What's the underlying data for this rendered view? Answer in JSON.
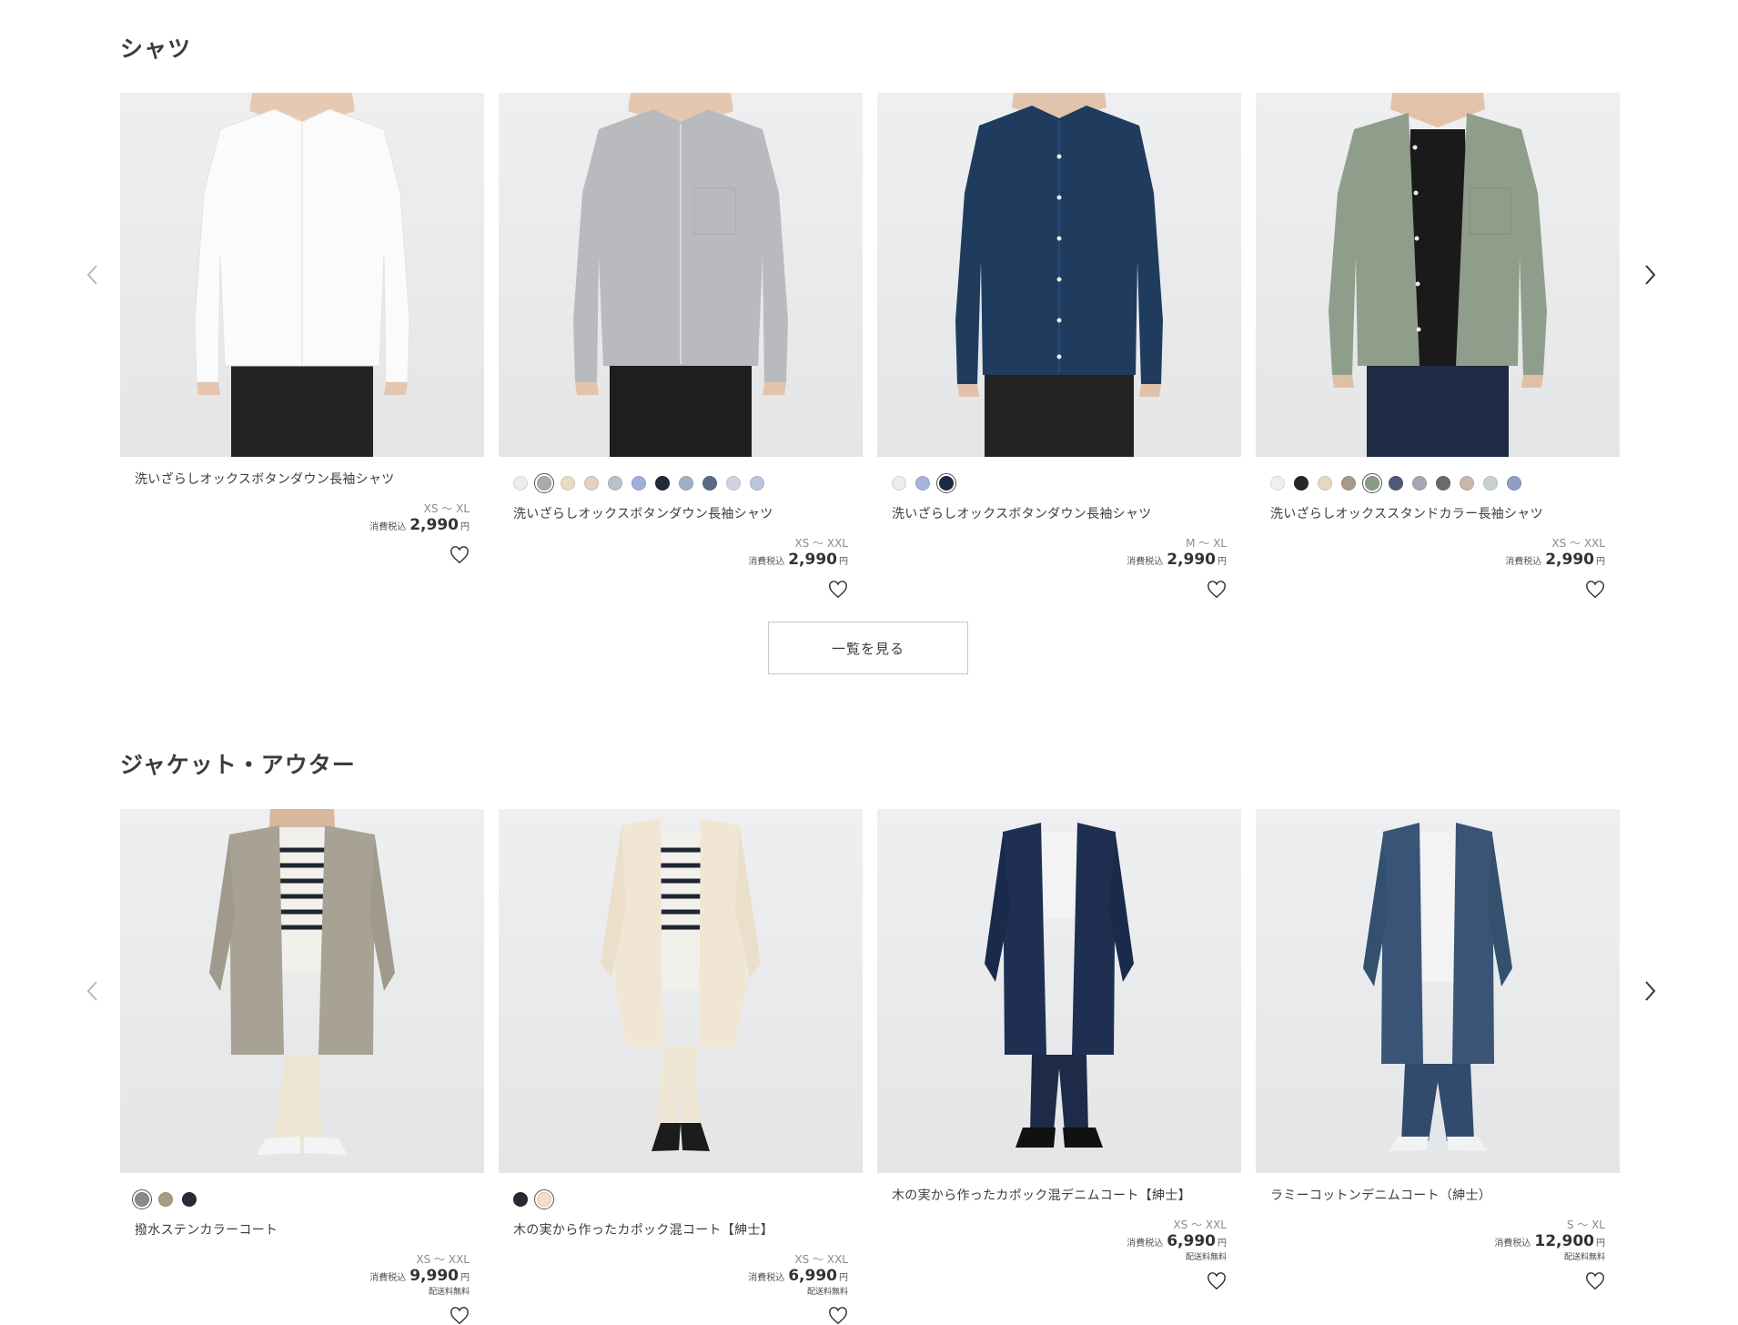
{
  "sections": [
    {
      "title": "シャツ",
      "view_all_label": "一覧を見る",
      "products": [
        {
          "name": "洗いざらしオックスボタンダウン長袖シャツ",
          "sizes": "XS 〜 XL",
          "tax_label": "消費税込",
          "price": "2,990",
          "currency": "円",
          "shipping": "",
          "swatches": [],
          "image_icon": "white-shirt-photo"
        },
        {
          "name": "洗いざらしオックスボタンダウン長袖シャツ",
          "sizes": "XS 〜 XXL",
          "tax_label": "消費税込",
          "price": "2,990",
          "currency": "円",
          "shipping": "",
          "swatches": [
            "#ececec",
            "#a9aab1",
            "#e8dcc6",
            "#e6cfbf",
            "#b6c3c9",
            "#9fb0db",
            "#1f2a3d",
            "#9fb0c4",
            "#5a6b86",
            "#cfd4e0",
            "#b9c6dc"
          ],
          "selected_swatch": 1,
          "image_icon": "gray-shirt-photo"
        },
        {
          "name": "洗いざらしオックスボタンダウン長袖シャツ",
          "sizes": "M 〜 XL",
          "tax_label": "消費税込",
          "price": "2,990",
          "currency": "円",
          "shipping": "",
          "swatches": [
            "#ececec",
            "#a9b4dc",
            "#1c2b44"
          ],
          "selected_swatch": 2,
          "image_icon": "navy-shirt-photo"
        },
        {
          "name": "洗いざらしオックススタンドカラー長袖シャツ",
          "sizes": "XS 〜 XXL",
          "tax_label": "消費税込",
          "price": "2,990",
          "currency": "円",
          "shipping": "",
          "swatches": [
            "#efefef",
            "#262626",
            "#e6d8c2",
            "#a79a8a",
            "#8a9b86",
            "#4d5a74",
            "#aaa5b6",
            "#6a6a6a",
            "#c9b7ac",
            "#c9d2d1",
            "#8e9fc4"
          ],
          "selected_swatch": 4,
          "image_icon": "green-shirt-photo"
        }
      ]
    },
    {
      "title": "ジャケット・アウター",
      "view_all_label": "",
      "products": [
        {
          "name": "撥水ステンカラーコート",
          "sizes": "XS 〜 XXL",
          "tax_label": "消費税込",
          "price": "9,990",
          "currency": "円",
          "shipping": "配送料無料",
          "swatches": [
            "#8e8a80",
            "#a89a84",
            "#262d36"
          ],
          "selected_swatch": 0,
          "image_icon": "beige-coat-photo"
        },
        {
          "name": "木の実から作ったカポック混コート【紳士】",
          "sizes": "XS 〜 XXL",
          "tax_label": "消費税込",
          "price": "6,990",
          "currency": "円",
          "shipping": "配送料無料",
          "swatches": [
            "#252a30",
            "#f1dfca"
          ],
          "selected_swatch": 1,
          "image_icon": "cream-coat-photo"
        },
        {
          "name": "木の実から作ったカポック混デニムコート【紳士】",
          "sizes": "XS 〜 XXL",
          "tax_label": "消費税込",
          "price": "6,990",
          "currency": "円",
          "shipping": "配送料無料",
          "swatches": [],
          "image_icon": "dark-denim-coat-photo"
        },
        {
          "name": "ラミーコットンデニムコート（紳士）",
          "sizes": "S 〜 XL",
          "tax_label": "消費税込",
          "price": "12,900",
          "currency": "円",
          "shipping": "配送料無料",
          "swatches": [],
          "image_icon": "denim-coat-photo"
        }
      ]
    }
  ],
  "icons": {
    "prev": "chevron-left-icon",
    "next": "chevron-right-icon",
    "favorite": "heart-outline-icon"
  }
}
